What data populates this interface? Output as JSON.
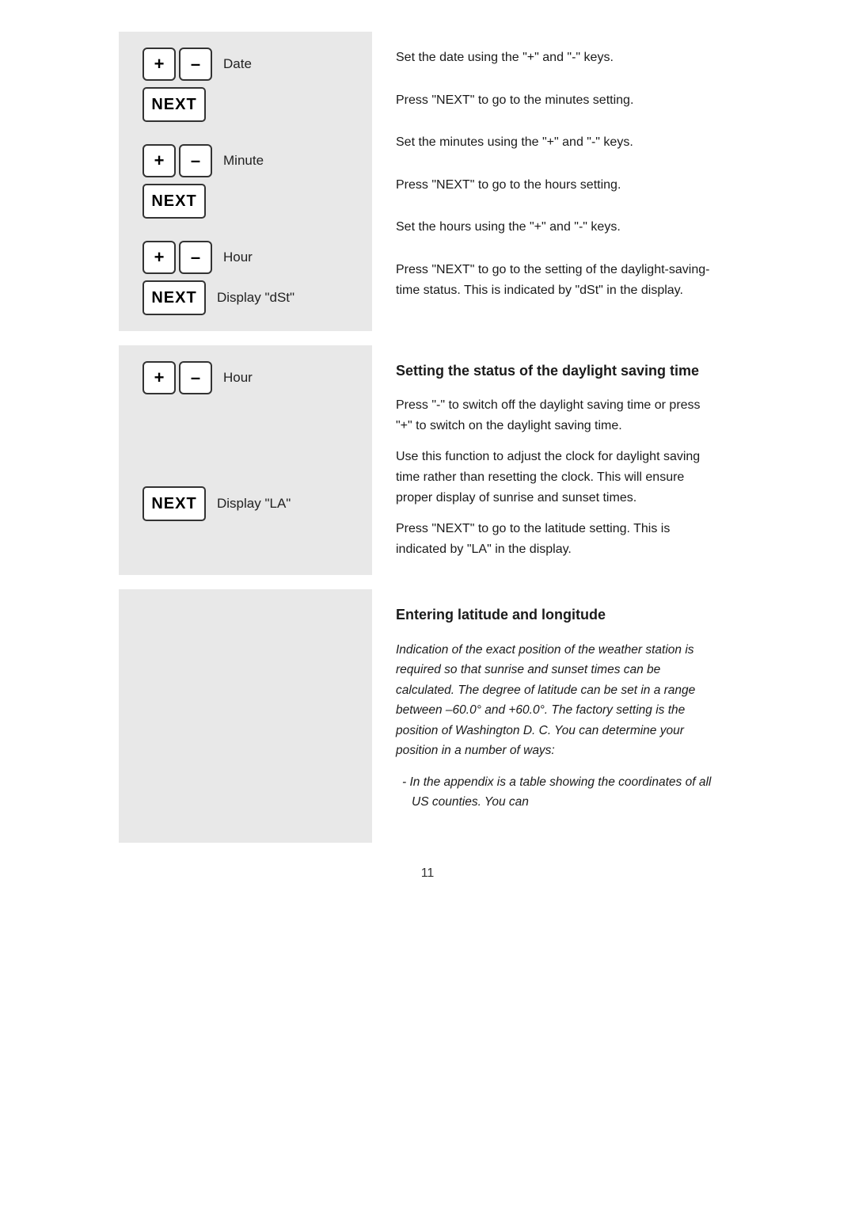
{
  "sections": [
    {
      "id": "date-section",
      "buttons": [
        {
          "label": "+",
          "name": "plus-date"
        },
        {
          "label": "–",
          "name": "minus-date"
        }
      ],
      "button_label": "Date",
      "next_label": "NEXT",
      "right_text_1": "Set the date using the \"+\" and \"-\" keys.",
      "right_text_2": "Press \"NEXT\" to go to the minutes setting."
    },
    {
      "id": "minute-section",
      "buttons": [
        {
          "label": "+",
          "name": "plus-minute"
        },
        {
          "label": "–",
          "name": "minus-minute"
        }
      ],
      "button_label": "Minute",
      "next_label": "NEXT",
      "right_text_1": "Set the minutes using the \"+\" and \"-\" keys.",
      "right_text_2": "Press \"NEXT\" to go to the hours setting."
    },
    {
      "id": "hour-section",
      "buttons": [
        {
          "label": "+",
          "name": "plus-hour"
        },
        {
          "label": "–",
          "name": "minus-hour"
        }
      ],
      "button_label": "Hour",
      "next_label": "NEXT",
      "next_display_label": "Display \"dSt\"",
      "right_text_1": "Set the hours using the \"+\" and \"-\" keys.",
      "right_text_2": "Press \"NEXT\" to go to the setting of the daylight-saving-time status. This is indicated by \"dSt\" in the display."
    }
  ],
  "dst_section": {
    "buttons": [
      {
        "label": "+",
        "name": "plus-dst"
      },
      {
        "label": "–",
        "name": "minus-dst"
      }
    ],
    "button_label": "Hour",
    "next_label": "NEXT",
    "next_display_label": "Display \"LA\"",
    "heading": "Setting the status of the daylight saving time",
    "paragraph_1": "Press \"-\" to switch off the daylight saving time or press \"+\" to switch on the daylight saving time.",
    "paragraph_2": "Use this function to adjust the clock for daylight saving time rather than resetting the clock. This will ensure proper display of sunrise and sunset times.",
    "right_text_next": "Press \"NEXT\" to go to the latitude setting. This is indicated by \"LA\" in the display."
  },
  "lat_lon_section": {
    "heading": "Entering latitude and longitude",
    "paragraph_italic": "Indication of the exact position of the weather station is required so that sunrise and sunset times can be calculated. The degree of latitude can be set in a range between –60.0° and +60.0°. The factory setting is the position of Washington D. C. You can determine your position in a number of ways:",
    "bullet": "In the appendix is a table showing the coordinates of all US counties. You can"
  },
  "page_number": "11"
}
